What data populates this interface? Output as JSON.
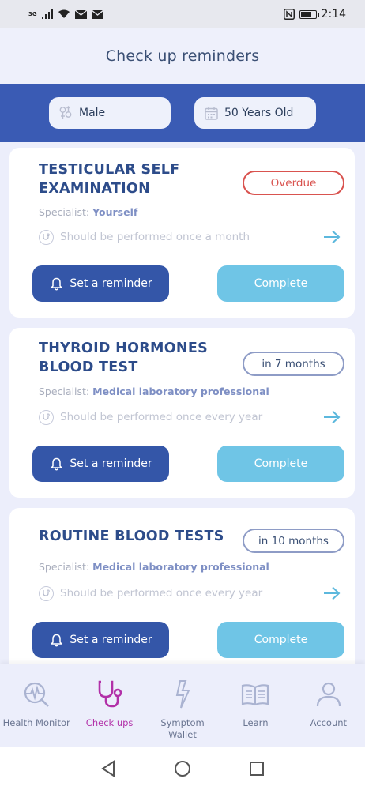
{
  "status_bar": {
    "network": "3G",
    "time": "2:14",
    "battery_level": 0.65
  },
  "header": {
    "title": "Check up reminders"
  },
  "filters": {
    "gender": "Male",
    "age": "50 Years Old"
  },
  "checkups": [
    {
      "title": "TESTICULAR SELF EXAMINATION",
      "status": "Overdue",
      "specialist_label": "Specialist:",
      "specialist": "Yourself",
      "frequency": "Should be performed once a month",
      "reminder_label": "Set a reminder",
      "complete_label": "Complete"
    },
    {
      "title": "THYROID HORMONES BLOOD TEST",
      "status": "in 7 months",
      "specialist_label": "Specialist:",
      "specialist": "Medical laboratory professional",
      "frequency": "Should be performed once every year",
      "reminder_label": "Set a reminder",
      "complete_label": "Complete"
    },
    {
      "title": "ROUTINE BLOOD TESTS",
      "status": "in 10 months",
      "specialist_label": "Specialist:",
      "specialist": "Medical laboratory professional",
      "frequency": "Should be performed once every year",
      "reminder_label": "Set a reminder",
      "complete_label": "Complete"
    }
  ],
  "nav": {
    "items": [
      {
        "label": "Health Monitor",
        "icon": "health-monitor-icon"
      },
      {
        "label": "Check ups",
        "icon": "stethoscope-icon",
        "active": true
      },
      {
        "label": "Symptom Wallet",
        "icon": "lightning-icon"
      },
      {
        "label": "Learn",
        "icon": "book-icon"
      },
      {
        "label": "Account",
        "icon": "person-icon"
      }
    ]
  },
  "colors": {
    "primary": "#3456a8",
    "accent": "#6fc5e6",
    "overdue": "#d9534f",
    "active_nav": "#b230a8"
  }
}
